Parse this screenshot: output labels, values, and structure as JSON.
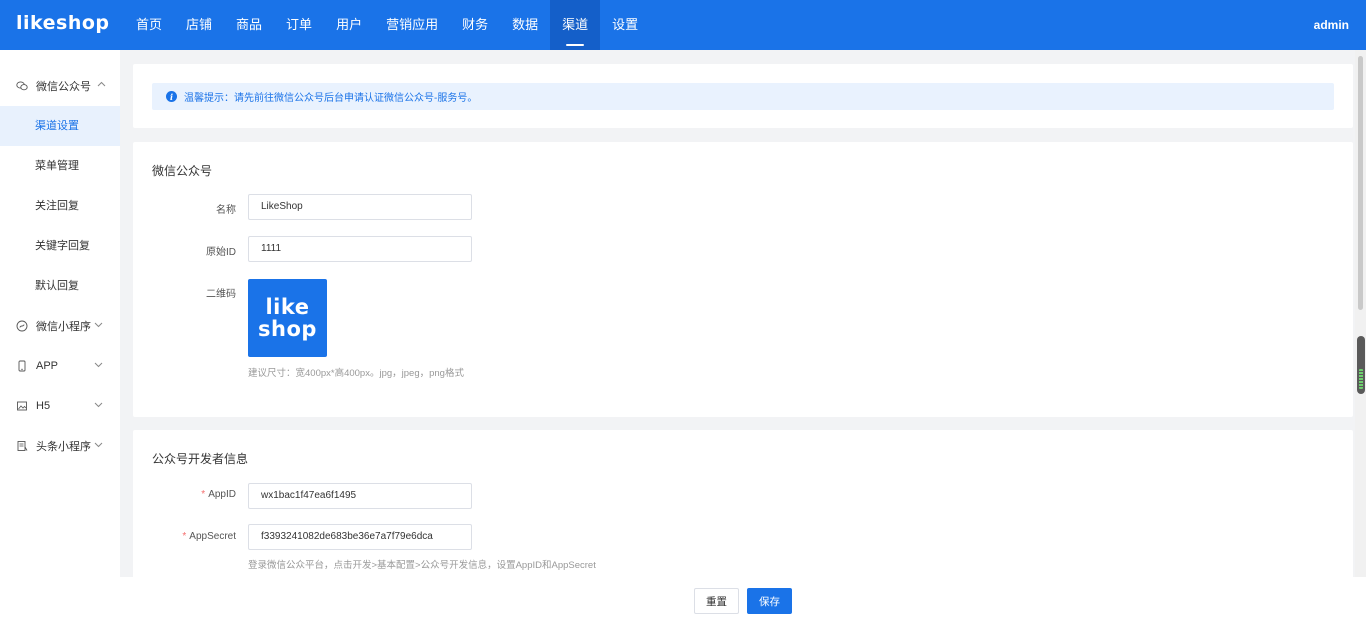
{
  "header": {
    "logo": "likeshop",
    "nav": [
      {
        "label": "首页"
      },
      {
        "label": "店铺"
      },
      {
        "label": "商品"
      },
      {
        "label": "订单"
      },
      {
        "label": "用户"
      },
      {
        "label": "营销应用"
      },
      {
        "label": "财务"
      },
      {
        "label": "数据"
      },
      {
        "label": "渠道",
        "active": true
      },
      {
        "label": "设置"
      }
    ],
    "user": "admin"
  },
  "sidebar": {
    "wechat_oa": {
      "label": "微信公众号",
      "icon": "wechat-icon",
      "expanded": true,
      "items": [
        "渠道设置",
        "菜单管理",
        "关注回复",
        "关键字回复",
        "默认回复"
      ],
      "active_item": "渠道设置"
    },
    "groups": [
      {
        "label": "微信小程序",
        "icon": "miniprogram-icon"
      },
      {
        "label": "APP",
        "icon": "phone-icon"
      },
      {
        "label": "H5",
        "icon": "image-icon"
      },
      {
        "label": "头条小程序",
        "icon": "toutiao-icon"
      }
    ]
  },
  "tip": {
    "text": "温馨提示：请先前往微信公众号后台申请认证微信公众号-服务号。"
  },
  "oa_card": {
    "title": "微信公众号",
    "name_label": "名称",
    "name_value": "LikeShop",
    "original_id_label": "原始ID",
    "original_id_value": "1111",
    "qrcode_label": "二维码",
    "qrcode_logo_line1": "like",
    "qrcode_logo_line2": "shop",
    "qrcode_hint": "建议尺寸：宽400px*高400px。jpg，jpeg，png格式"
  },
  "dev_card": {
    "title": "公众号开发者信息",
    "appid_label": "AppID",
    "appid_value": "wx1bac1f47ea6f1495",
    "appsecret_label": "AppSecret",
    "appsecret_value": "f3393241082de683be36e7a7f79e6dca",
    "appsecret_hint": "登录微信公众平台，点击开发>基本配置>公众号开发信息，设置AppID和AppSecret"
  },
  "footer": {
    "reset_label": "重置",
    "save_label": "保存"
  },
  "colors": {
    "primary": "#1a73e8",
    "required": "#f56c6c"
  }
}
